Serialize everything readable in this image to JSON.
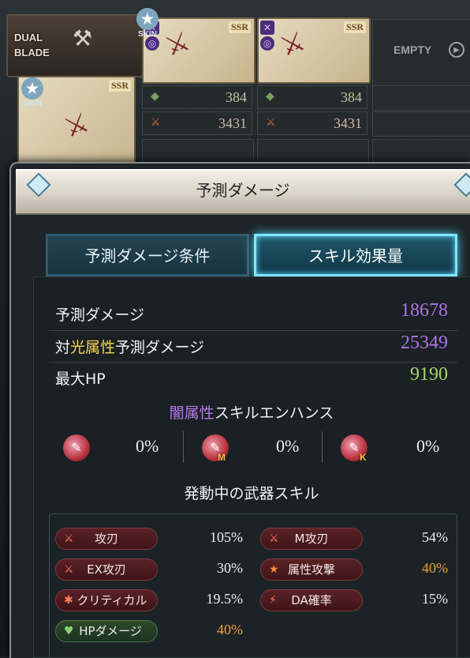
{
  "background": {
    "dual_blade_label": "DUAL\nBLADE",
    "skin_label": "SKIN",
    "ssr_label": "SSR",
    "stats": [
      {
        "hp": "384",
        "atk": "3431"
      },
      {
        "hp": "384",
        "atk": "3431"
      }
    ],
    "empty_label": "EMPTY"
  },
  "popup": {
    "title": "予測ダメージ",
    "tabs": {
      "conditions": "予測ダメージ条件",
      "effects": "スキル効果量"
    },
    "predicted": {
      "label": "予測ダメージ",
      "value": "18678"
    },
    "vs_light": {
      "label_prefix": "対",
      "label_element": "光属性",
      "label_suffix": "予測ダメージ",
      "value": "25349"
    },
    "max_hp": {
      "label": "最大HP",
      "value": "9190"
    },
    "enhance": {
      "title_element": "闇属性",
      "title_suffix": "スキルエンハンス",
      "items": [
        {
          "icon": "normal-skill-icon",
          "sub": "",
          "value": "0%"
        },
        {
          "icon": "magna-skill-icon",
          "sub": "M",
          "value": "0%"
        },
        {
          "icon": "ex-skill-icon",
          "sub": "K",
          "value": "0%"
        }
      ]
    },
    "weapon_skills": {
      "title": "発動中の武器スキル",
      "items": [
        {
          "label": "攻刃",
          "value": "105%",
          "icon": "sword-icon"
        },
        {
          "label": "M攻刃",
          "value": "54%",
          "icon": "sword-icon"
        },
        {
          "label": "EX攻刃",
          "value": "30%",
          "icon": "sword-icon"
        },
        {
          "label": "属性攻撃",
          "value": "40%",
          "icon": "star-icon"
        },
        {
          "label": "クリティカル",
          "value": "19.5%",
          "icon": "burst-icon"
        },
        {
          "label": "DA確率",
          "value": "15%",
          "icon": "double-slash-icon"
        },
        {
          "label": "HPダメージ",
          "value": "40%",
          "icon": "broken-heart-icon"
        }
      ]
    }
  }
}
